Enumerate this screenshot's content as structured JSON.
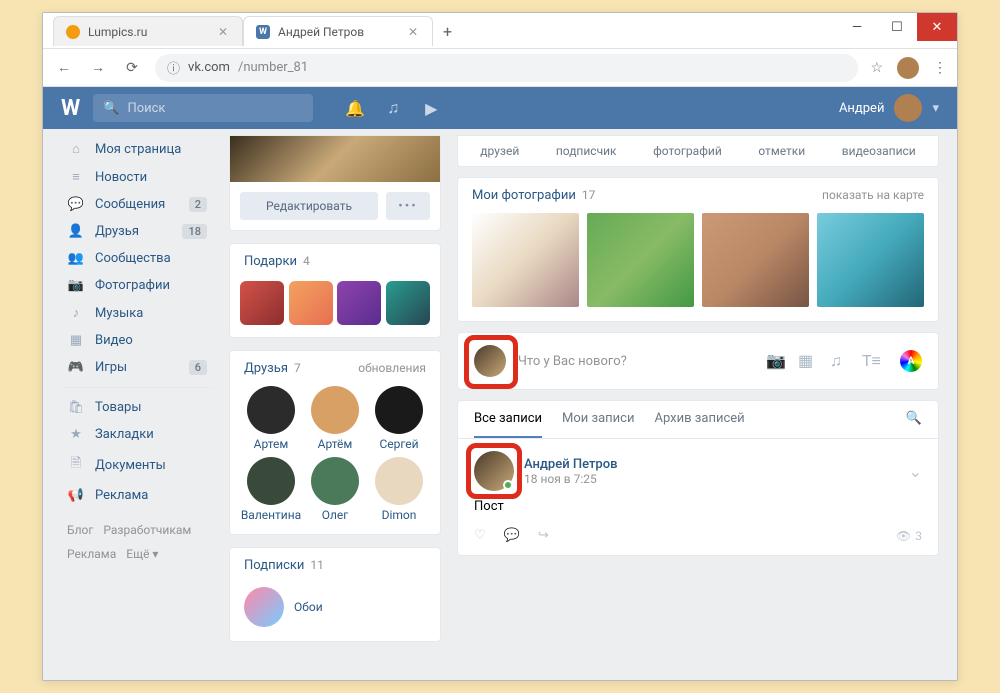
{
  "browser": {
    "tabs": [
      {
        "title": "Lumpics.ru",
        "favicon": "#f39c12",
        "active": false
      },
      {
        "title": "Андрей Петров",
        "favicon": "#4a76a8",
        "active": true
      }
    ],
    "url_host": "vk.com",
    "url_path": "/number_81"
  },
  "vk_header": {
    "search_placeholder": "Поиск",
    "username": "Андрей"
  },
  "left_nav": [
    {
      "icon": "home",
      "label": "Моя страница",
      "badge": ""
    },
    {
      "icon": "news",
      "label": "Новости",
      "badge": ""
    },
    {
      "icon": "msg",
      "label": "Сообщения",
      "badge": "2"
    },
    {
      "icon": "friends",
      "label": "Друзья",
      "badge": "18"
    },
    {
      "icon": "groups",
      "label": "Сообщества",
      "badge": ""
    },
    {
      "icon": "photo",
      "label": "Фотографии",
      "badge": ""
    },
    {
      "icon": "music",
      "label": "Музыка",
      "badge": ""
    },
    {
      "icon": "video",
      "label": "Видео",
      "badge": ""
    },
    {
      "icon": "games",
      "label": "Игры",
      "badge": "6"
    },
    {
      "sep": true
    },
    {
      "icon": "market",
      "label": "Товары",
      "badge": ""
    },
    {
      "icon": "fav",
      "label": "Закладки",
      "badge": ""
    },
    {
      "icon": "docs",
      "label": "Документы",
      "badge": ""
    },
    {
      "icon": "ads",
      "label": "Реклама",
      "badge": ""
    }
  ],
  "left_footer": [
    "Блог",
    "Разработчикам",
    "Реклама",
    "Ещё ▾"
  ],
  "profile": {
    "edit_label": "Редактировать"
  },
  "gifts": {
    "title": "Подарки",
    "count": "4"
  },
  "friends_module": {
    "title": "Друзья",
    "count": "7",
    "updates": "обновления",
    "list": [
      {
        "name": "Артем",
        "bg": "#2b2b2b"
      },
      {
        "name": "Артём",
        "bg": "#d9a066"
      },
      {
        "name": "Сергей",
        "bg": "#1a1a1a"
      },
      {
        "name": "Валентина",
        "bg": "#3a4a3a"
      },
      {
        "name": "Олег",
        "bg": "#4a7a5a"
      },
      {
        "name": "Dimon",
        "bg": "#e8d8c0"
      }
    ]
  },
  "subs": {
    "title": "Подписки",
    "count": "11",
    "item": "Обои"
  },
  "stats": [
    "друзей",
    "подписчик",
    "фотографий",
    "отметки",
    "видеозаписи"
  ],
  "photos": {
    "title": "Мои фотографии",
    "count": "17",
    "map": "показать на карте"
  },
  "post_input": {
    "placeholder": "Что у Вас нового?"
  },
  "wall_tabs": {
    "all": "Все записи",
    "mine": "Мои записи",
    "archive": "Архив записей"
  },
  "post": {
    "author": "Андрей Петров",
    "date": "18 ноя в 7:25",
    "text": "Пост",
    "views": "3"
  }
}
